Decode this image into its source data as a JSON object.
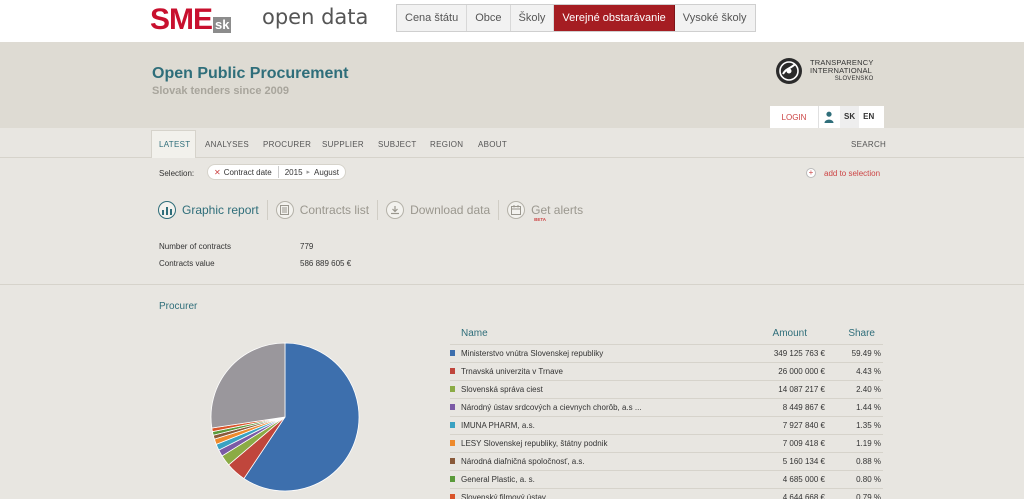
{
  "brand": {
    "logo_main": "SME",
    "logo_suffix": "sk",
    "product": "open data"
  },
  "topnav": [
    {
      "label": "Cena štátu",
      "active": false
    },
    {
      "label": "Obce",
      "active": false
    },
    {
      "label": "Školy",
      "active": false
    },
    {
      "label": "Verejné obstarávanie",
      "active": true
    },
    {
      "label": "Vysoké školy",
      "active": false
    }
  ],
  "header": {
    "title": "Open Public Procurement",
    "subtitle": "Slovak tenders since 2009",
    "partner_line1": "TRANSPARENCY",
    "partner_line2": "INTERNATIONAL",
    "partner_line3": "SLOVENSKO"
  },
  "userbar": {
    "login": "LOGIN",
    "lang_sk": "SK",
    "lang_en": "EN"
  },
  "subnav": {
    "latest": "LATEST",
    "analyses": "ANALYSES",
    "procurer": "PROCURER",
    "supplier": "SUPPLIER",
    "subject": "SUBJECT",
    "region": "REGION",
    "about": "ABOUT",
    "search": "SEARCH"
  },
  "selection": {
    "label": "Selection:",
    "chip_name": "Contract date",
    "chip_year": "2015",
    "chip_month": "August",
    "add": "add to selection"
  },
  "tools": {
    "graphic": "Graphic report",
    "contracts": "Contracts list",
    "download": "Download data",
    "alerts": "Get alerts",
    "beta": "BETA"
  },
  "stats": {
    "count_label": "Number of contracts",
    "count_value": "779",
    "value_label": "Contracts value",
    "value_value": "586 889 605 €"
  },
  "procurer": {
    "title": "Procurer",
    "col_name": "Name",
    "col_amount": "Amount",
    "col_share": "Share"
  },
  "table_rows": [
    {
      "name": "Ministerstvo vnútra Slovenskej republiky",
      "amount": "349 125 763 €",
      "share": "59.49 %",
      "color": "#3d6fad"
    },
    {
      "name": "Trnavská univerzita v Trnave",
      "amount": "26 000 000 €",
      "share": "4.43 %",
      "color": "#c0463c"
    },
    {
      "name": "Slovenská správa ciest",
      "amount": "14 087 217 €",
      "share": "2.40 %",
      "color": "#8bab45"
    },
    {
      "name": "Národný ústav srdcových a cievnych chorôb, a.s ...",
      "amount": "8 449 867 €",
      "share": "1.44 %",
      "color": "#7b5aa6"
    },
    {
      "name": "IMUNA PHARM, a.s.",
      "amount": "7 927 840 €",
      "share": "1.35 %",
      "color": "#3aa2c2"
    },
    {
      "name": "LESY Slovenskej republiky, štátny podnik",
      "amount": "7 009 418 €",
      "share": "1.19 %",
      "color": "#ee8a2c"
    },
    {
      "name": "Národná diaľničná spoločnosť, a.s.",
      "amount": "5 160 134 €",
      "share": "0.88 %",
      "color": "#8a5a3a"
    },
    {
      "name": "General Plastic, a. s.",
      "amount": "4 685 000 €",
      "share": "0.80 %",
      "color": "#5a9a3a"
    },
    {
      "name": "Slovenský filmový ústav",
      "amount": "4 644 668 €",
      "share": "0.79 %",
      "color": "#d9542a"
    }
  ],
  "chart_data": {
    "type": "pie",
    "title": "",
    "slices": [
      {
        "label": "Ministerstvo vnútra Slovenskej republiky",
        "value": 59.49,
        "color": "#3d6fad"
      },
      {
        "label": "Trnavská univerzita v Trnave",
        "value": 4.43,
        "color": "#c0463c"
      },
      {
        "label": "Slovenská správa ciest",
        "value": 2.4,
        "color": "#8bab45"
      },
      {
        "label": "Národný ústav srdcových a cievnych chorôb, a.s ...",
        "value": 1.44,
        "color": "#7b5aa6"
      },
      {
        "label": "IMUNA PHARM, a.s.",
        "value": 1.35,
        "color": "#3aa2c2"
      },
      {
        "label": "LESY Slovenskej republiky, štátny podnik",
        "value": 1.19,
        "color": "#ee8a2c"
      },
      {
        "label": "Národná diaľničná spoločnosť, a.s.",
        "value": 0.88,
        "color": "#8a5a3a"
      },
      {
        "label": "General Plastic, a. s.",
        "value": 0.8,
        "color": "#5a9a3a"
      },
      {
        "label": "Slovenský filmový ústav",
        "value": 0.79,
        "color": "#d9542a"
      },
      {
        "label": "",
        "value": 27.43,
        "color": "#9a979c"
      }
    ]
  }
}
